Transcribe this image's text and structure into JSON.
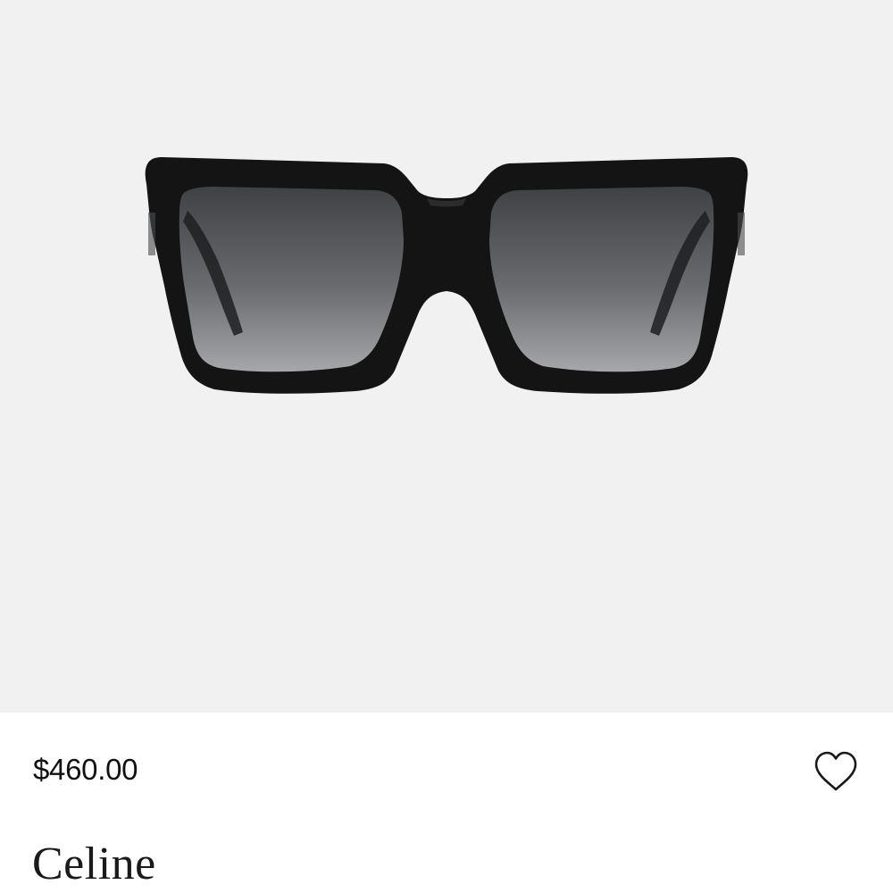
{
  "product": {
    "price": "$460.00",
    "brand": "Celine",
    "image_icon": "sunglasses-product-image"
  },
  "actions": {
    "wishlist_icon": "heart-icon"
  },
  "colors": {
    "image_background": "#f1f1f1",
    "frame": "#141414",
    "text": "#111111"
  }
}
